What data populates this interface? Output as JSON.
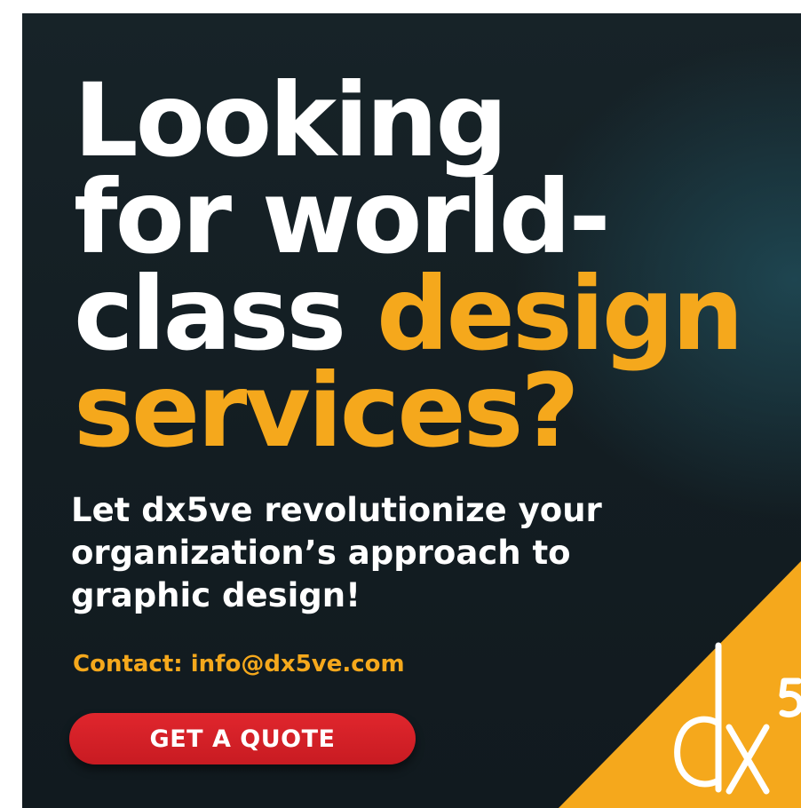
{
  "headline": {
    "line1": "Looking",
    "line2": "for world-",
    "line3_white": "class ",
    "line3_accent": "design",
    "line4_accent": "services?"
  },
  "subhead": {
    "line1": "Let dx5ve revolutionize your",
    "line2": "organization’s approach to",
    "line3": "graphic design!"
  },
  "contact": "Contact: info@dx5ve.com",
  "cta": {
    "label": "GET A QUOTE"
  },
  "logo": {
    "icon": "dx5-logo-icon"
  },
  "colors": {
    "background": "#131d22",
    "accent": "#f5a81c",
    "button": "#d42027",
    "text": "#ffffff"
  }
}
